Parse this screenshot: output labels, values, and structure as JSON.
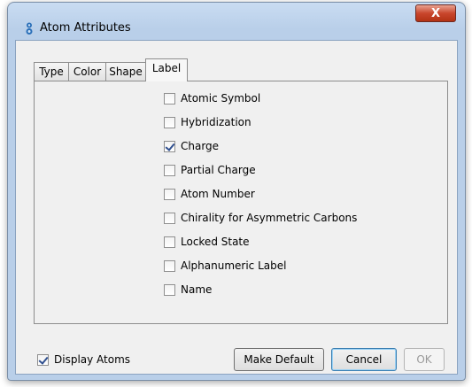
{
  "window": {
    "title": "Atom Attributes",
    "close_label": "X"
  },
  "tabs": [
    {
      "label": "Type",
      "active": false
    },
    {
      "label": "Color",
      "active": false
    },
    {
      "label": "Shape",
      "active": false
    },
    {
      "label": "Label",
      "active": true
    }
  ],
  "label_options": [
    {
      "label": "Atomic Symbol",
      "checked": false
    },
    {
      "label": "Hybridization",
      "checked": false
    },
    {
      "label": "Charge",
      "checked": true
    },
    {
      "label": "Partial Charge",
      "checked": false
    },
    {
      "label": "Atom Number",
      "checked": false
    },
    {
      "label": "Chirality for Asymmetric Carbons",
      "checked": false
    },
    {
      "label": "Locked State",
      "checked": false
    },
    {
      "label": "Alphanumeric Label",
      "checked": false
    },
    {
      "label": "Name",
      "checked": false
    }
  ],
  "footer": {
    "display_atoms": {
      "label": "Display Atoms",
      "checked": true
    },
    "make_default_label": "Make Default",
    "cancel_label": "Cancel",
    "ok_label": "OK"
  }
}
